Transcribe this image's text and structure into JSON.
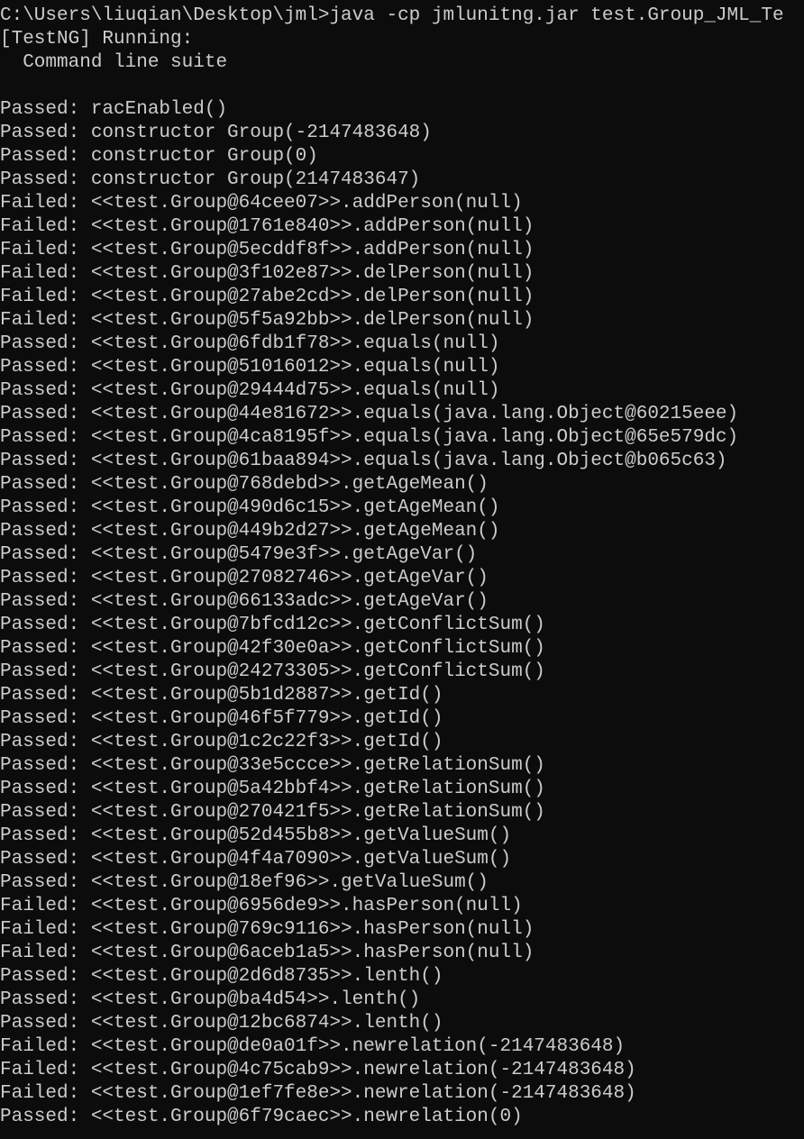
{
  "window": {
    "background": "#0c0c0c",
    "foreground": "#cccccc"
  },
  "console": {
    "lines": [
      "C:\\Users\\liuqian\\Desktop\\jml>java -cp jmlunitng.jar test.Group_JML_Te",
      "[TestNG] Running:",
      "  Command line suite",
      "",
      "Passed: racEnabled()",
      "Passed: constructor Group(-2147483648)",
      "Passed: constructor Group(0)",
      "Passed: constructor Group(2147483647)",
      "Failed: <<test.Group@64cee07>>.addPerson(null)",
      "Failed: <<test.Group@1761e840>>.addPerson(null)",
      "Failed: <<test.Group@5ecddf8f>>.addPerson(null)",
      "Failed: <<test.Group@3f102e87>>.delPerson(null)",
      "Failed: <<test.Group@27abe2cd>>.delPerson(null)",
      "Failed: <<test.Group@5f5a92bb>>.delPerson(null)",
      "Passed: <<test.Group@6fdb1f78>>.equals(null)",
      "Passed: <<test.Group@51016012>>.equals(null)",
      "Passed: <<test.Group@29444d75>>.equals(null)",
      "Passed: <<test.Group@44e81672>>.equals(java.lang.Object@60215eee)",
      "Passed: <<test.Group@4ca8195f>>.equals(java.lang.Object@65e579dc)",
      "Passed: <<test.Group@61baa894>>.equals(java.lang.Object@b065c63)",
      "Passed: <<test.Group@768debd>>.getAgeMean()",
      "Passed: <<test.Group@490d6c15>>.getAgeMean()",
      "Passed: <<test.Group@449b2d27>>.getAgeMean()",
      "Passed: <<test.Group@5479e3f>>.getAgeVar()",
      "Passed: <<test.Group@27082746>>.getAgeVar()",
      "Passed: <<test.Group@66133adc>>.getAgeVar()",
      "Passed: <<test.Group@7bfcd12c>>.getConflictSum()",
      "Passed: <<test.Group@42f30e0a>>.getConflictSum()",
      "Passed: <<test.Group@24273305>>.getConflictSum()",
      "Passed: <<test.Group@5b1d2887>>.getId()",
      "Passed: <<test.Group@46f5f779>>.getId()",
      "Passed: <<test.Group@1c2c22f3>>.getId()",
      "Passed: <<test.Group@33e5ccce>>.getRelationSum()",
      "Passed: <<test.Group@5a42bbf4>>.getRelationSum()",
      "Passed: <<test.Group@270421f5>>.getRelationSum()",
      "Passed: <<test.Group@52d455b8>>.getValueSum()",
      "Passed: <<test.Group@4f4a7090>>.getValueSum()",
      "Passed: <<test.Group@18ef96>>.getValueSum()",
      "Failed: <<test.Group@6956de9>>.hasPerson(null)",
      "Failed: <<test.Group@769c9116>>.hasPerson(null)",
      "Failed: <<test.Group@6aceb1a5>>.hasPerson(null)",
      "Passed: <<test.Group@2d6d8735>>.lenth()",
      "Passed: <<test.Group@ba4d54>>.lenth()",
      "Passed: <<test.Group@12bc6874>>.lenth()",
      "Failed: <<test.Group@de0a01f>>.newrelation(-2147483648)",
      "Failed: <<test.Group@4c75cab9>>.newrelation(-2147483648)",
      "Failed: <<test.Group@1ef7fe8e>>.newrelation(-2147483648)",
      "Passed: <<test.Group@6f79caec>>.newrelation(0)"
    ]
  }
}
